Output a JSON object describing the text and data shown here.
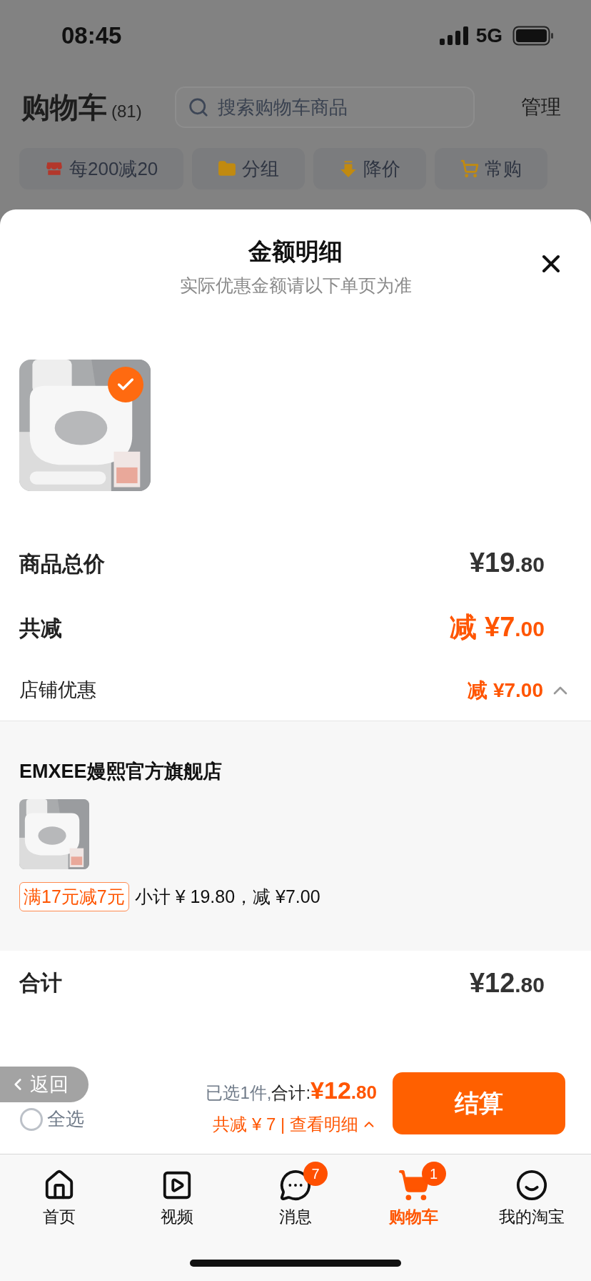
{
  "status_bar": {
    "time": "08:45",
    "network": "5G"
  },
  "header": {
    "title": "购物车",
    "count": "(81)",
    "search_placeholder": "搜索购物车商品",
    "manage": "管理"
  },
  "chips": [
    {
      "label": "每200减20",
      "kind": "promo"
    },
    {
      "label": "分组",
      "kind": "group"
    },
    {
      "label": "降价",
      "kind": "price_drop"
    },
    {
      "label": "常购",
      "kind": "frequent"
    }
  ],
  "sheet": {
    "title": "金额明细",
    "subtitle": "实际优惠金额请以下单页为准",
    "products": [
      {
        "kind": "picture",
        "selected": true
      }
    ],
    "rows": [
      {
        "label": "商品总价",
        "value": "¥19.80",
        "kind": "price"
      },
      {
        "label": "共减",
        "value": "减 ¥7.00",
        "kind": "discount"
      },
      {
        "label": "店铺优惠",
        "value": "减 ¥7.00",
        "kind": "detail",
        "expanded": true
      }
    ],
    "store": {
      "name": "EMXEE嫚熙官方旗舰店",
      "products": [
        {
          "kind": "picture"
        }
      ],
      "tag": "满17元减7元",
      "subtotal": "小计 ¥ 19.80，减 ¥7.00"
    },
    "total": {
      "label": "合计",
      "value": "¥12.80"
    }
  },
  "bottom_bar": {
    "back": "返回",
    "select_all": {
      "label": "全选",
      "checked": false
    },
    "selected_info": "已选1件,",
    "total_label": "合计:",
    "total": "¥12.80",
    "discount": "共减 ¥ 7 | 查看明细",
    "expanded": false,
    "checkout": "结算"
  },
  "tabs": [
    {
      "label": "首页",
      "kind": "home",
      "selected": false
    },
    {
      "label": "视频",
      "kind": "video",
      "selected": false
    },
    {
      "label": "消息",
      "kind": "message",
      "selected": false,
      "badge": "7"
    },
    {
      "label": "购物车",
      "kind": "cart",
      "selected": true,
      "badge": "1"
    },
    {
      "label": "我的淘宝",
      "kind": "profile",
      "selected": false
    }
  ]
}
